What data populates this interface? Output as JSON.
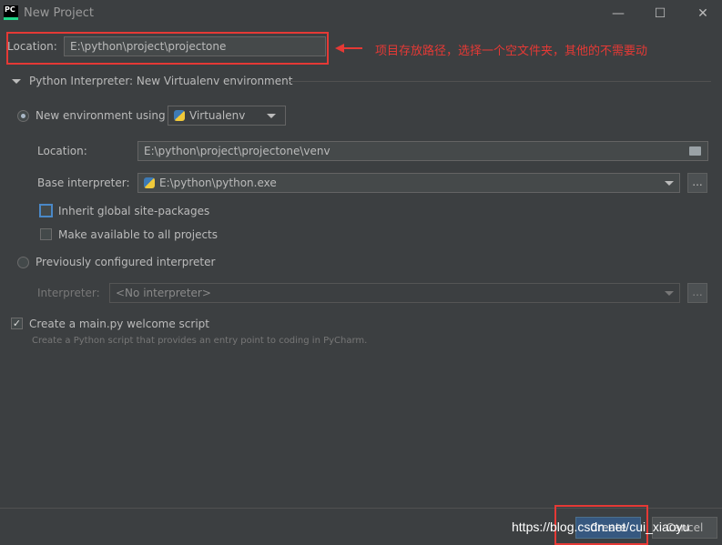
{
  "window": {
    "title": "New Project",
    "min": "—",
    "max": "☐",
    "close": "✕",
    "logo": "PC"
  },
  "location": {
    "label": "Location:",
    "value": "E:\\python\\project\\projectone"
  },
  "annotation": {
    "text": "项目存放路径，选择一个空文件夹，其他的不需要动",
    "color": "#e53935"
  },
  "interpreter_section": {
    "title": "Python Interpreter: New Virtualenv environment"
  },
  "new_env": {
    "label": "New environment using",
    "tool": "Virtualenv",
    "location_label": "Location:",
    "location_value": "E:\\python\\project\\projectone\\venv",
    "base_label": "Base interpreter:",
    "base_value": "E:\\python\\python.exe",
    "browse": "...",
    "inherit_label": "Inherit global site-packages",
    "available_label": "Make available to all projects"
  },
  "previous": {
    "label": "Previously configured interpreter",
    "interp_label": "Interpreter:",
    "interp_value": "<No interpreter>",
    "browse": "..."
  },
  "welcome": {
    "label": "Create a main.py welcome script",
    "hint": "Create a Python script that provides an entry point to coding in PyCharm."
  },
  "footer": {
    "create": "Create",
    "cancel": "Cancel",
    "watermark": "https://blog.csdn.net/cui_xiaoyu"
  }
}
